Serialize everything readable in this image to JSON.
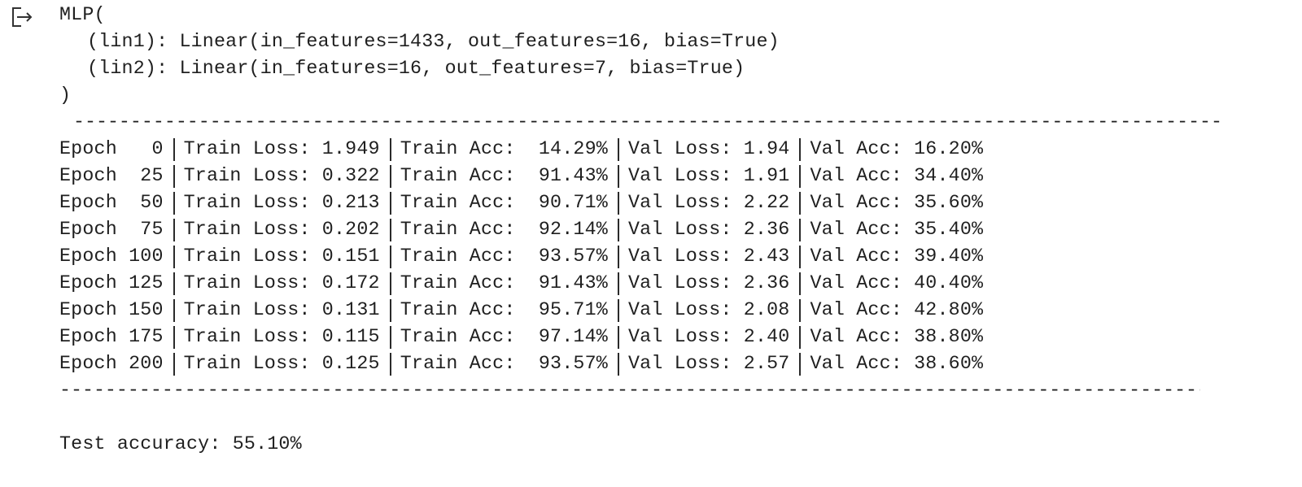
{
  "model_repr": {
    "header": "MLP(",
    "layers": [
      "(lin1): Linear(in_features=1433, out_features=16, bias=True)",
      "(lin2): Linear(in_features=16, out_features=7, bias=True)"
    ],
    "footer": ")"
  },
  "log": {
    "top_rule": "---------------------------------------------------------------------------------------------------------------------",
    "bottom_rule": "--------------------------------------------------------------------------------------------------------------------",
    "rows": [
      {
        "epoch": "Epoch   0",
        "train_loss": "Train Loss: 1.949",
        "train_acc": "Train Acc:  14.29%",
        "val_loss": "Val Loss: 1.94",
        "val_acc": "Val Acc: 16.20%"
      },
      {
        "epoch": "Epoch  25",
        "train_loss": "Train Loss: 0.322",
        "train_acc": "Train Acc:  91.43%",
        "val_loss": "Val Loss: 1.91",
        "val_acc": "Val Acc: 34.40%"
      },
      {
        "epoch": "Epoch  50",
        "train_loss": "Train Loss: 0.213",
        "train_acc": "Train Acc:  90.71%",
        "val_loss": "Val Loss: 2.22",
        "val_acc": "Val Acc: 35.60%"
      },
      {
        "epoch": "Epoch  75",
        "train_loss": "Train Loss: 0.202",
        "train_acc": "Train Acc:  92.14%",
        "val_loss": "Val Loss: 2.36",
        "val_acc": "Val Acc: 35.40%"
      },
      {
        "epoch": "Epoch 100",
        "train_loss": "Train Loss: 0.151",
        "train_acc": "Train Acc:  93.57%",
        "val_loss": "Val Loss: 2.43",
        "val_acc": "Val Acc: 39.40%"
      },
      {
        "epoch": "Epoch 125",
        "train_loss": "Train Loss: 0.172",
        "train_acc": "Train Acc:  91.43%",
        "val_loss": "Val Loss: 2.36",
        "val_acc": "Val Acc: 40.40%"
      },
      {
        "epoch": "Epoch 150",
        "train_loss": "Train Loss: 0.131",
        "train_acc": "Train Acc:  95.71%",
        "val_loss": "Val Loss: 2.08",
        "val_acc": "Val Acc: 42.80%"
      },
      {
        "epoch": "Epoch 175",
        "train_loss": "Train Loss: 0.115",
        "train_acc": "Train Acc:  97.14%",
        "val_loss": "Val Loss: 2.40",
        "val_acc": "Val Acc: 38.80%"
      },
      {
        "epoch": "Epoch 200",
        "train_loss": "Train Loss: 0.125",
        "train_acc": "Train Acc:  93.57%",
        "val_loss": "Val Loss: 2.57",
        "val_acc": "Val Acc: 38.60%"
      }
    ]
  },
  "test_result": "Test accuracy: 55.10%",
  "icons": {
    "output": "output-redirect-icon"
  },
  "colors": {
    "text": "#1f1f1f",
    "background": "#ffffff"
  }
}
